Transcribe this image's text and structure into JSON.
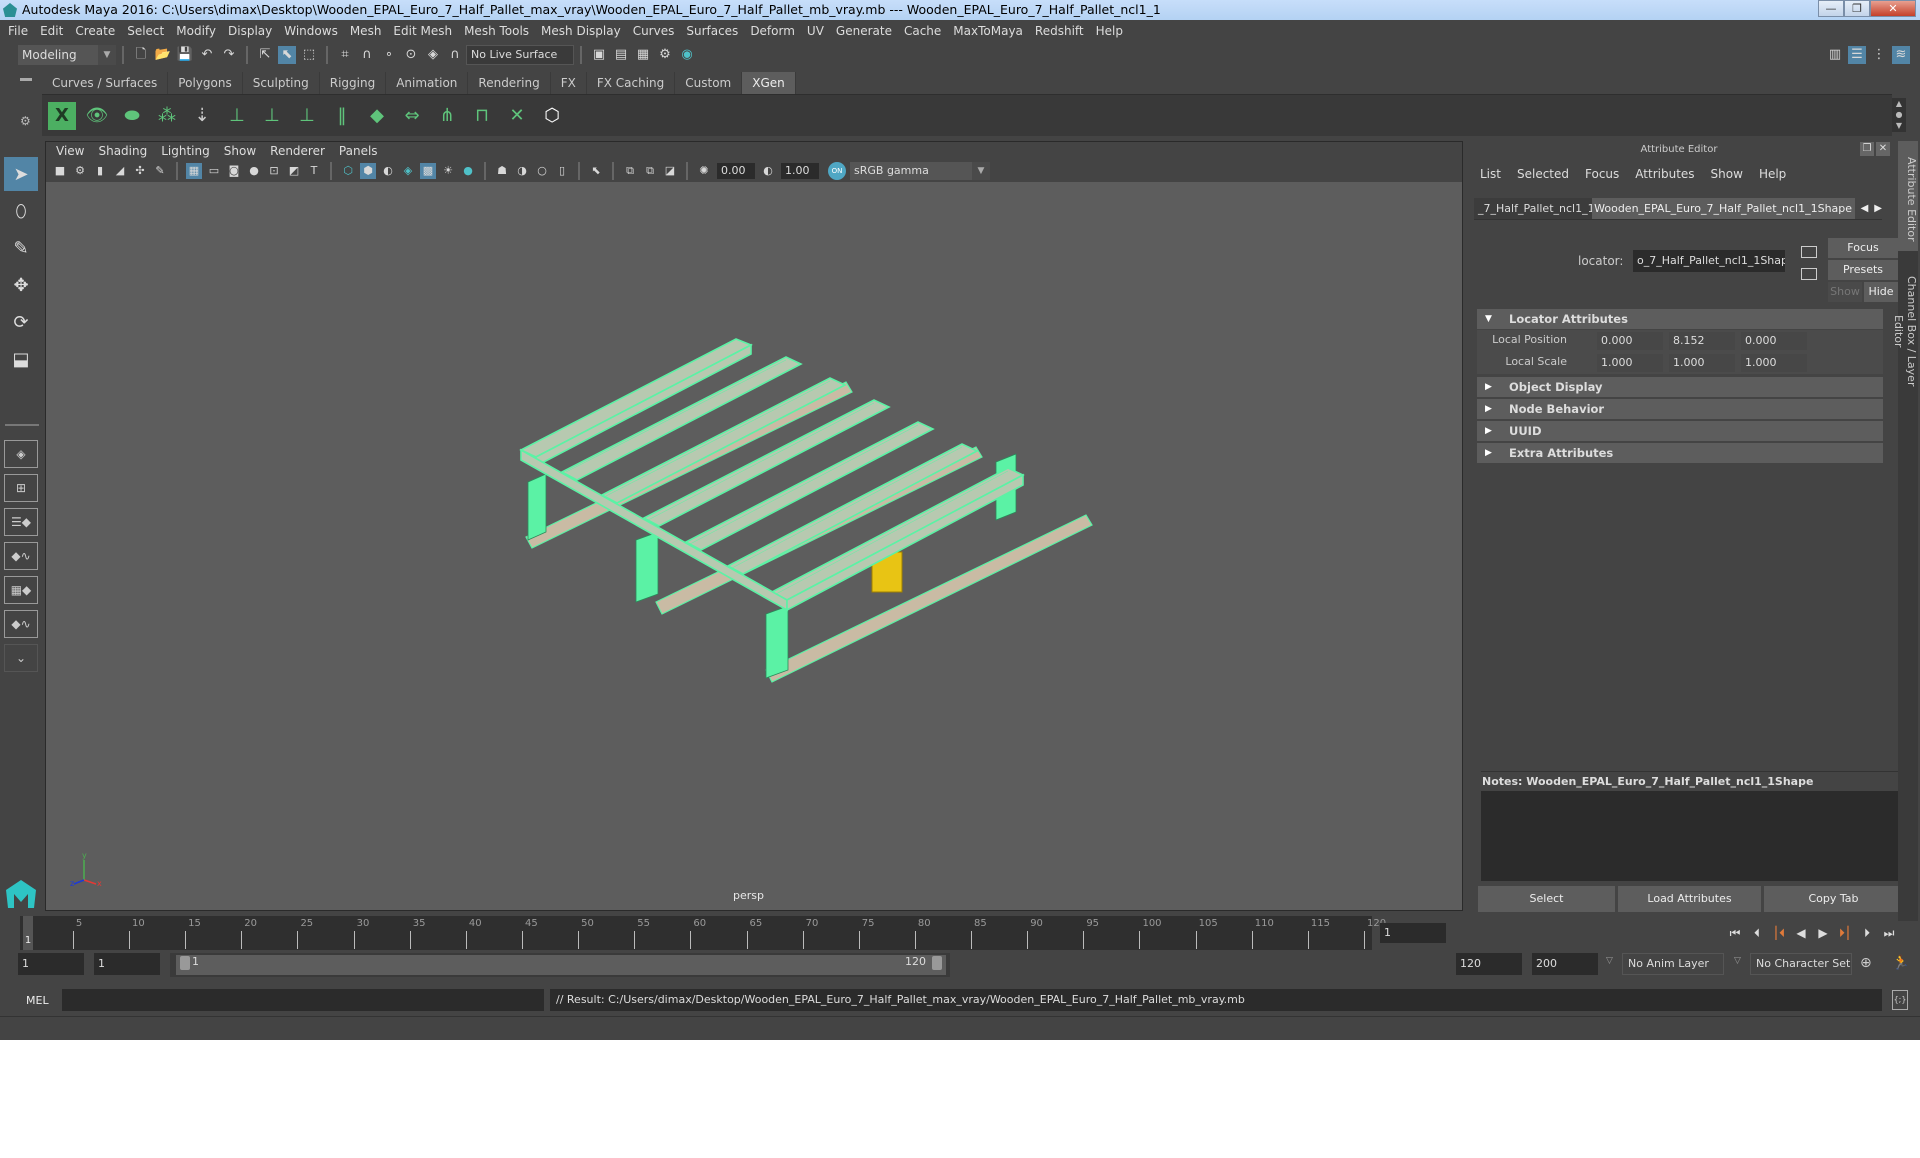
{
  "window": {
    "title": "Autodesk Maya 2016: C:\\Users\\dimax\\Desktop\\Wooden_EPAL_Euro_7_Half_Pallet_max_vray\\Wooden_EPAL_Euro_7_Half_Pallet_mb_vray.mb   ---   Wooden_EPAL_Euro_7_Half_Pallet_ncl1_1",
    "controls": {
      "minimize": "—",
      "maximize": "❐",
      "close": "✕"
    }
  },
  "menubar": [
    "File",
    "Edit",
    "Create",
    "Select",
    "Modify",
    "Display",
    "Windows",
    "Mesh",
    "Edit Mesh",
    "Mesh Tools",
    "Mesh Display",
    "Curves",
    "Surfaces",
    "Deform",
    "UV",
    "Generate",
    "Cache",
    "MaxToMaya",
    "Redshift",
    "Help"
  ],
  "statusline": {
    "mode": "Modeling",
    "live_surface": "No Live Surface",
    "icons": [
      "new-scene",
      "open-scene",
      "save-scene",
      "undo",
      "redo",
      "select-hierarchy",
      "select-object",
      "select-component",
      "snap-grid",
      "snap-curve",
      "snap-point",
      "snap-projected",
      "snap-view",
      "make-live",
      "render-frame",
      "render-sequence",
      "ipr-render",
      "render-settings",
      "hypershade"
    ]
  },
  "shelf": {
    "tabs": [
      "Curves / Surfaces",
      "Polygons",
      "Sculpting",
      "Rigging",
      "Animation",
      "Rendering",
      "FX",
      "FX Caching",
      "Custom",
      "XGen"
    ],
    "active_tab": "XGen",
    "tools": [
      "xgen-editor",
      "show-xgen",
      "hide-xgen",
      "create-description",
      "place-guides",
      "add-guide",
      "toggle-guide-display",
      "lock-guides",
      "select-guides",
      "sculpt-guides",
      "convert-guides",
      "interactive-groom",
      "groom-tool",
      "delete-guides",
      "xgen-library"
    ]
  },
  "toolbox": {
    "tools": [
      "select-tool",
      "lasso-tool",
      "paint-select-tool",
      "move-tool",
      "rotate-tool",
      "scale-tool"
    ],
    "active": "select-tool",
    "layouts": [
      "single-pane",
      "four-pane",
      "outliner-persp",
      "persp-graph",
      "hypershade-persp",
      "persp-graph-outliner",
      "more-layouts"
    ]
  },
  "viewport": {
    "menus": [
      "View",
      "Shading",
      "Lighting",
      "Show",
      "Renderer",
      "Panels"
    ],
    "exposure": "0.00",
    "gamma": "1.00",
    "color_mgmt": "ON",
    "view_transform": "sRGB gamma",
    "camera_label": "persp",
    "axes": {
      "x": "x",
      "y": "y",
      "z": "z"
    },
    "wire_color": "#5bf2a5",
    "selected_color": "#e8c414"
  },
  "attribute_editor": {
    "title": "Attribute Editor",
    "menus": [
      "List",
      "Selected",
      "Focus",
      "Attributes",
      "Show",
      "Help"
    ],
    "tabs": [
      "_7_Half_Pallet_ncl1_1",
      "Wooden_EPAL_Euro_7_Half_Pallet_ncl1_1Shape"
    ],
    "active_tab": "Wooden_EPAL_Euro_7_Half_Pallet_ncl1_1Shape",
    "node_type_label": "locator:",
    "node_name": "o_7_Half_Pallet_ncl1_1Shape",
    "buttons": {
      "focus": "Focus",
      "presets": "Presets",
      "show": "Show",
      "hide": "Hide"
    },
    "sections": [
      {
        "label": "Locator Attributes",
        "expanded": true
      },
      {
        "label": "Object Display",
        "expanded": false
      },
      {
        "label": "Node Behavior",
        "expanded": false
      },
      {
        "label": "UUID",
        "expanded": false
      },
      {
        "label": "Extra Attributes",
        "expanded": false
      }
    ],
    "attributes": [
      {
        "label": "Local Position",
        "values": [
          "0.000",
          "8.152",
          "0.000"
        ]
      },
      {
        "label": "Local Scale",
        "values": [
          "1.000",
          "1.000",
          "1.000"
        ]
      }
    ],
    "notes_label": "Notes:  Wooden_EPAL_Euro_7_Half_Pallet_ncl1_1Shape",
    "bottom_buttons": [
      "Select",
      "Load Attributes",
      "Copy Tab"
    ]
  },
  "side_tabs": [
    "Attribute Editor",
    "Channel Box / Layer Editor"
  ],
  "timeline": {
    "ticks": [
      "5",
      "10",
      "15",
      "20",
      "25",
      "30",
      "35",
      "40",
      "45",
      "50",
      "55",
      "60",
      "65",
      "70",
      "75",
      "80",
      "85",
      "90",
      "95",
      "100",
      "105",
      "110",
      "115",
      "120"
    ],
    "current_frame": "1",
    "current_frame_field": "1",
    "playback": [
      "go-to-start",
      "step-back-key",
      "step-back-frame",
      "play-backward",
      "play-forward",
      "step-forward-frame",
      "step-forward-key",
      "go-to-end"
    ]
  },
  "range": {
    "start": "1",
    "playback_start": "1",
    "slider_start": "1",
    "slider_end": "120",
    "playback_end": "120",
    "end": "200",
    "anim_layer": "No Anim Layer",
    "character_set": "No Character Set"
  },
  "command_line": {
    "label": "MEL",
    "input": "",
    "result": "// Result: C:/Users/dimax/Desktop/Wooden_EPAL_Euro_7_Half_Pallet_max_vray/Wooden_EPAL_Euro_7_Half_Pallet_mb_vray.mb"
  }
}
